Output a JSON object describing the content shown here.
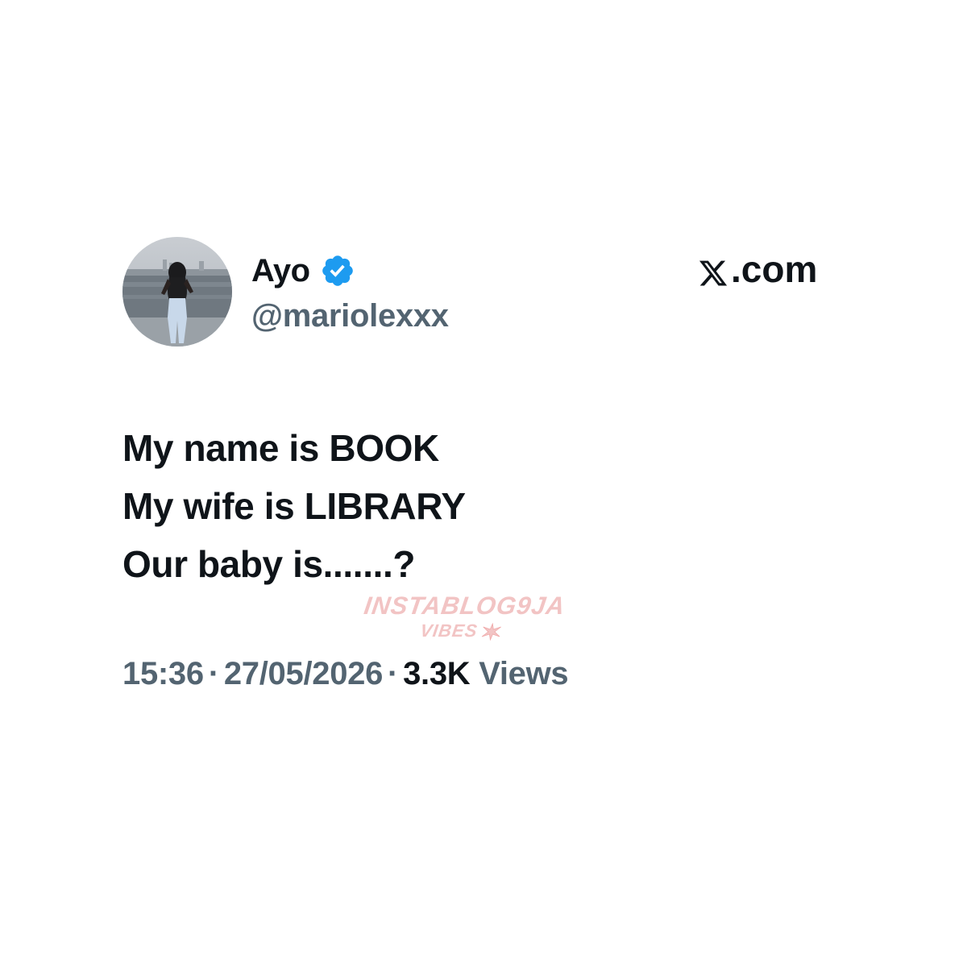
{
  "author": {
    "display_name": "Ayo",
    "handle": "@mariolexxx",
    "verified": true,
    "verified_color": "#1d9bf0"
  },
  "brand": {
    "label": ".com",
    "icon": "x-logo-icon"
  },
  "tweet": {
    "lines": [
      "My name is BOOK",
      "My wife is LIBRARY",
      "Our baby is.......?"
    ]
  },
  "meta": {
    "time": "15:36",
    "separator": "·",
    "date": "27/05/2026",
    "views_count": "3.3K",
    "views_label": "Views"
  },
  "watermark": {
    "line1": "INSTABLOG9JA",
    "line2": "VIBES"
  },
  "colors": {
    "text_primary": "#0f1419",
    "text_secondary": "#536471",
    "watermark": "#f2c4c4"
  }
}
